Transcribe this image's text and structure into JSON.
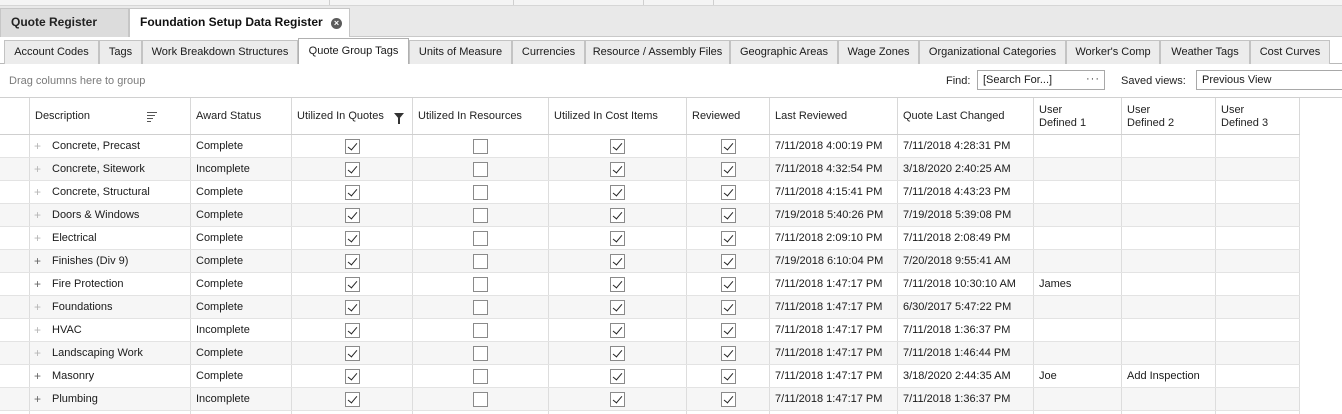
{
  "doc_tabs": [
    {
      "label": "Quote Register",
      "active": false
    },
    {
      "label": "Foundation Setup Data Register",
      "active": true
    }
  ],
  "sub_tabs": [
    {
      "label": "Account Codes"
    },
    {
      "label": "Tags"
    },
    {
      "label": "Work Breakdown Structures"
    },
    {
      "label": "Quote Group Tags",
      "active": true
    },
    {
      "label": "Units of Measure"
    },
    {
      "label": "Currencies"
    },
    {
      "label": "Resource / Assembly Files"
    },
    {
      "label": "Geographic Areas"
    },
    {
      "label": "Wage Zones"
    },
    {
      "label": "Organizational Categories"
    },
    {
      "label": "Worker's Comp"
    },
    {
      "label": "Weather Tags"
    },
    {
      "label": "Cost Curves"
    }
  ],
  "toolbar": {
    "group_hint": "Drag columns here to group",
    "find_label": "Find:",
    "search_placeholder": "[Search For...]",
    "search_dots": "···",
    "saved_views_label": "Saved views:",
    "saved_view_value": "Previous View"
  },
  "columns": [
    {
      "key": "description",
      "label": "Description",
      "icon": "sort-icon"
    },
    {
      "key": "award",
      "label": "Award Status"
    },
    {
      "key": "quotes",
      "label": "Utilized In Quotes",
      "icon": "filter-icon"
    },
    {
      "key": "resources",
      "label": "Utilized In Resources"
    },
    {
      "key": "cost",
      "label": "Utilized In Cost Items"
    },
    {
      "key": "reviewed",
      "label": "Reviewed"
    },
    {
      "key": "last_reviewed",
      "label": "Last Reviewed"
    },
    {
      "key": "quote_changed",
      "label": "Quote Last Changed"
    },
    {
      "key": "u1",
      "label": [
        "User",
        "Defined 1"
      ]
    },
    {
      "key": "u2",
      "label": [
        "User",
        "Defined 2"
      ]
    },
    {
      "key": "u3",
      "label": [
        "User",
        "Defined 3"
      ]
    }
  ],
  "rows": [
    {
      "expander": "dim",
      "description": "Concrete, Precast",
      "award": "Complete",
      "quotes": true,
      "resources": false,
      "cost": true,
      "reviewed": true,
      "last_reviewed": "7/11/2018 4:00:19 PM",
      "quote_changed": "7/11/2018 4:28:31 PM",
      "u1": "",
      "u2": "",
      "u3": ""
    },
    {
      "expander": "dim",
      "description": "Concrete, Sitework",
      "award": "Incomplete",
      "quotes": true,
      "resources": false,
      "cost": true,
      "reviewed": true,
      "last_reviewed": "7/11/2018 4:32:54 PM",
      "quote_changed": "3/18/2020 2:40:25 AM",
      "u1": "",
      "u2": "",
      "u3": ""
    },
    {
      "expander": "dim",
      "description": "Concrete, Structural",
      "award": "Complete",
      "quotes": true,
      "resources": false,
      "cost": true,
      "reviewed": true,
      "last_reviewed": "7/11/2018 4:15:41 PM",
      "quote_changed": "7/11/2018 4:43:23 PM",
      "u1": "",
      "u2": "",
      "u3": ""
    },
    {
      "expander": "dim",
      "description": "Doors & Windows",
      "award": "Complete",
      "quotes": true,
      "resources": false,
      "cost": true,
      "reviewed": true,
      "last_reviewed": "7/19/2018 5:40:26 PM",
      "quote_changed": "7/19/2018 5:39:08 PM",
      "u1": "",
      "u2": "",
      "u3": ""
    },
    {
      "expander": "dim",
      "description": "Electrical",
      "award": "Complete",
      "quotes": true,
      "resources": false,
      "cost": true,
      "reviewed": true,
      "last_reviewed": "7/11/2018 2:09:10 PM",
      "quote_changed": "7/11/2018 2:08:49 PM",
      "u1": "",
      "u2": "",
      "u3": ""
    },
    {
      "expander": "dark",
      "description": "Finishes (Div 9)",
      "award": "Complete",
      "quotes": true,
      "resources": false,
      "cost": true,
      "reviewed": true,
      "last_reviewed": "7/19/2018 6:10:04 PM",
      "quote_changed": "7/20/2018 9:55:41 AM",
      "u1": "",
      "u2": "",
      "u3": ""
    },
    {
      "expander": "dark",
      "description": "Fire Protection",
      "award": "Complete",
      "quotes": true,
      "resources": false,
      "cost": true,
      "reviewed": true,
      "last_reviewed": "7/11/2018 1:47:17 PM",
      "quote_changed": "7/11/2018 10:30:10 AM",
      "u1": "James",
      "u2": "",
      "u3": ""
    },
    {
      "expander": "dim",
      "description": "Foundations",
      "award": "Complete",
      "quotes": true,
      "resources": false,
      "cost": true,
      "reviewed": true,
      "last_reviewed": "7/11/2018 1:47:17 PM",
      "quote_changed": "6/30/2017 5:47:22 PM",
      "u1": "",
      "u2": "",
      "u3": ""
    },
    {
      "expander": "dim",
      "description": "HVAC",
      "award": "Incomplete",
      "quotes": true,
      "resources": false,
      "cost": true,
      "reviewed": true,
      "last_reviewed": "7/11/2018 1:47:17 PM",
      "quote_changed": "7/11/2018 1:36:37 PM",
      "u1": "",
      "u2": "",
      "u3": ""
    },
    {
      "expander": "dim",
      "description": "Landscaping Work",
      "award": "Complete",
      "quotes": true,
      "resources": false,
      "cost": true,
      "reviewed": true,
      "last_reviewed": "7/11/2018 1:47:17 PM",
      "quote_changed": "7/11/2018 1:46:44 PM",
      "u1": "",
      "u2": "",
      "u3": ""
    },
    {
      "expander": "dark",
      "description": "Masonry",
      "award": "Complete",
      "quotes": true,
      "resources": false,
      "cost": true,
      "reviewed": true,
      "last_reviewed": "7/11/2018 1:47:17 PM",
      "quote_changed": "3/18/2020 2:44:35 AM",
      "u1": "Joe",
      "u2": "Add Inspection",
      "u3": ""
    },
    {
      "expander": "dark",
      "description": "Plumbing",
      "award": "Incomplete",
      "quotes": true,
      "resources": false,
      "cost": true,
      "reviewed": true,
      "last_reviewed": "7/11/2018 1:47:17 PM",
      "quote_changed": "7/11/2018 1:36:37 PM",
      "u1": "",
      "u2": "",
      "u3": ""
    },
    {
      "expander": "dim",
      "description": "",
      "award": "",
      "quotes": null,
      "resources": null,
      "cost": null,
      "reviewed": null,
      "last_reviewed": "",
      "quote_changed": "",
      "u1": "",
      "u2": "",
      "u3": ""
    }
  ]
}
